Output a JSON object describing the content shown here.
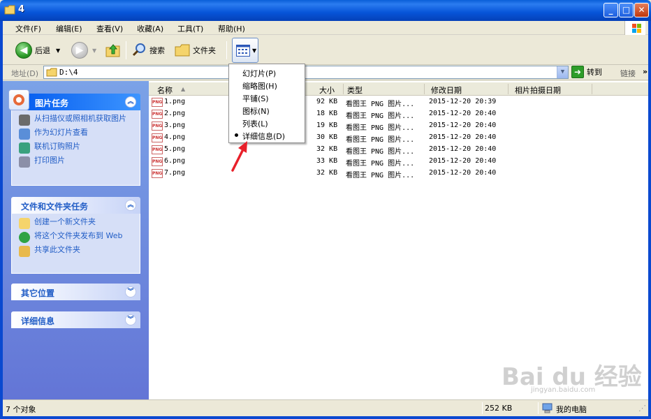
{
  "window": {
    "title": "4",
    "controls": {
      "minimize": "_",
      "maximize": "□",
      "close": "✕"
    }
  },
  "menubar": [
    "文件(F)",
    "编辑(E)",
    "查看(V)",
    "收藏(A)",
    "工具(T)",
    "帮助(H)"
  ],
  "toolbar": {
    "back": "后退",
    "search": "搜索",
    "folders": "文件夹"
  },
  "address": {
    "label": "地址(D)",
    "value": "D:\\4",
    "go": "转到",
    "links": "链接"
  },
  "taskpane": {
    "picture_tasks": {
      "title": "图片任务",
      "items": [
        "从扫描仪或照相机获取图片",
        "作为幻灯片查看",
        "联机订购照片",
        "打印图片"
      ]
    },
    "file_tasks": {
      "title": "文件和文件夹任务",
      "items": [
        "创建一个新文件夹",
        "将这个文件夹发布到 Web",
        "共享此文件夹"
      ]
    },
    "other_places": {
      "title": "其它位置"
    },
    "details": {
      "title": "详细信息"
    }
  },
  "columns": {
    "name": "名称",
    "size": "大小",
    "type": "类型",
    "modified": "修改日期",
    "taken": "相片拍摄日期"
  },
  "files": [
    {
      "name": "1.png",
      "size": "92 KB",
      "type": "看图王 PNG 图片...",
      "modified": "2015-12-20 20:39"
    },
    {
      "name": "2.png",
      "size": "18 KB",
      "type": "看图王 PNG 图片...",
      "modified": "2015-12-20 20:40"
    },
    {
      "name": "3.png",
      "size": "19 KB",
      "type": "看图王 PNG 图片...",
      "modified": "2015-12-20 20:40"
    },
    {
      "name": "4.png",
      "size": "30 KB",
      "type": "看图王 PNG 图片...",
      "modified": "2015-12-20 20:40"
    },
    {
      "name": "5.png",
      "size": "32 KB",
      "type": "看图王 PNG 图片...",
      "modified": "2015-12-20 20:40"
    },
    {
      "name": "6.png",
      "size": "33 KB",
      "type": "看图王 PNG 图片...",
      "modified": "2015-12-20 20:40"
    },
    {
      "name": "7.png",
      "size": "32 KB",
      "type": "看图王 PNG 图片...",
      "modified": "2015-12-20 20:40"
    }
  ],
  "views_menu": {
    "items": [
      "幻灯片(P)",
      "缩略图(H)",
      "平铺(S)",
      "图标(N)",
      "列表(L)",
      "详细信息(D)"
    ],
    "selected": "详细信息(D)"
  },
  "status": {
    "count": "7 个对象",
    "size": "252 KB",
    "location": "我的电脑"
  },
  "watermark": {
    "brand": "Bai du 经验",
    "url": "jingyan.baidu.com"
  },
  "file_icon_label": "PNG"
}
